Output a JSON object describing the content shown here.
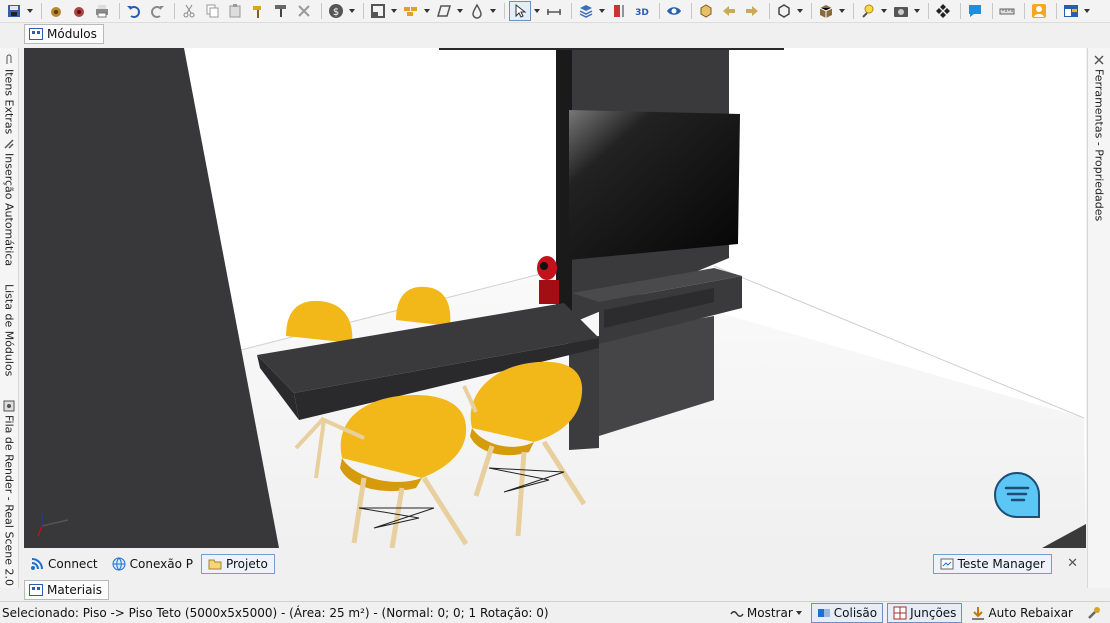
{
  "modules_tab": {
    "label": "Módulos"
  },
  "left_tabs": [
    {
      "label": "Itens Extras"
    },
    {
      "label": "Inserção Automática"
    },
    {
      "label": "Lista de Módulos"
    },
    {
      "label": "Fila de Render - Real Scene 2.0"
    }
  ],
  "right_tab": {
    "label": "Ferramentas - Propriedades"
  },
  "panel_tabs": [
    {
      "label": "Connect"
    },
    {
      "label": "Conexão P"
    },
    {
      "label": "Projeto"
    }
  ],
  "manager_tab": {
    "label": "Teste Manager",
    "close": "✕"
  },
  "materials_tab": {
    "label": "Materiais"
  },
  "status": {
    "selection": "Selecionado: Piso -> Piso Teto (5000x5x5000) - (Área: 25 m²) - (Normal: 0; 0; 1 Rotação: 0)",
    "show_label": "Mostrar",
    "collision_label": "Colisão",
    "joints_label": "Junções",
    "auto_lower_label": "Auto Rebaixar"
  },
  "colors": {
    "accent": "#1f6fd1",
    "chair": "#f2b81a",
    "cabinet": "#3a3a3c",
    "chat_bubble": "#5cc6f5"
  }
}
